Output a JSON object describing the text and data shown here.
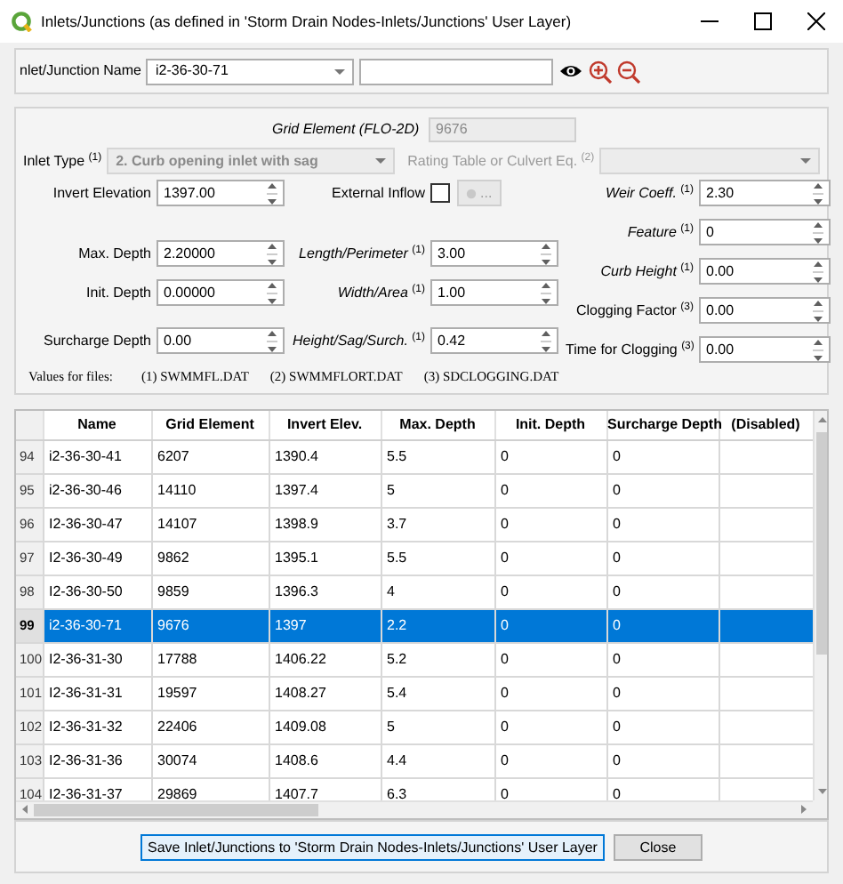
{
  "window": {
    "title": "Inlets/Junctions (as defined in 'Storm Drain Nodes-Inlets/Junctions' User Layer)"
  },
  "name_row": {
    "label": "nlet/Junction Name",
    "value": "i2-36-30-71"
  },
  "form": {
    "grid_element": {
      "label": "Grid Element (FLO-2D)",
      "italic": true,
      "value": "9676",
      "disabled": true
    },
    "inlet_type": {
      "label": "Inlet Type $^{(1)}$",
      "value": "2. Curb opening inlet with sag",
      "disabled": true
    },
    "rating_table": {
      "label": "Rating Table or Culvert Eq. $^{(2)}$",
      "disabled": true
    },
    "left": [
      {
        "label": "Invert Elevation",
        "value": "1397.00"
      },
      {
        "label": "Max. Depth",
        "value": "2.20000"
      },
      {
        "label": "Init. Depth",
        "value": "0.00000"
      },
      {
        "label": "Surcharge Depth",
        "value": "0.00"
      }
    ],
    "middle": [
      {
        "kind": "checkbox",
        "label": "External Inflow",
        "checked": false,
        "button_label": "...",
        "button_disabled": true
      },
      {
        "kind": "spin",
        "label": "*Length/Perimeter* $^{(1)}$",
        "value": "3.00"
      },
      {
        "kind": "spin",
        "label": "*Width/Area* $^{(1)}$",
        "value": "1.00"
      },
      {
        "kind": "spin",
        "label": "*Height/Sag/Surch.* $^{(1)}$",
        "value": "0.42"
      }
    ],
    "right": [
      {
        "label": "*Weir Coeff.* $^{(1)}$",
        "value": "2.30"
      },
      {
        "label": "*Feature* $^{(1)}$",
        "value": "0"
      },
      {
        "label": "*Curb Height* $^{(1)}$",
        "value": "0.00"
      },
      {
        "label": "Clogging Factor $^{(3)}$",
        "value": "0.00"
      },
      {
        "label": "Time for Clogging $^{(3)}$",
        "value": "0.00"
      }
    ],
    "notes": [
      "Values for files:",
      "(1) SWMMFL.DAT",
      "(2) SWMMFLORT.DAT",
      "(3) SDCLOGGING.DAT"
    ]
  },
  "table": {
    "columns": [
      "Name",
      "Grid Element",
      "Invert Elev.",
      "Max. Depth",
      "Init. Depth",
      "Surcharge Depth",
      "(Disabled)"
    ],
    "rows": [
      {
        "number": "94",
        "cells": [
          "i2-36-30-41",
          "6207",
          "1390.4",
          "5.5",
          "0",
          "0"
        ],
        "selected": false
      },
      {
        "number": "95",
        "cells": [
          "i2-36-30-46",
          "14110",
          "1397.4",
          "5",
          "0",
          "0"
        ],
        "selected": false
      },
      {
        "number": "96",
        "cells": [
          "I2-36-30-47",
          "14107",
          "1398.9",
          "3.7",
          "0",
          "0"
        ],
        "selected": false
      },
      {
        "number": "97",
        "cells": [
          "I2-36-30-49",
          "9862",
          "1395.1",
          "5.5",
          "0",
          "0"
        ],
        "selected": false
      },
      {
        "number": "98",
        "cells": [
          "I2-36-30-50",
          "9859",
          "1396.3",
          "4",
          "0",
          "0"
        ],
        "selected": false
      },
      {
        "number": "99",
        "cells": [
          "i2-36-30-71",
          "9676",
          "1397",
          "2.2",
          "0",
          "0"
        ],
        "selected": true
      },
      {
        "number": "100",
        "cells": [
          "I2-36-31-30",
          "17788",
          "1406.22",
          "5.2",
          "0",
          "0"
        ],
        "selected": false
      },
      {
        "number": "101",
        "cells": [
          "I2-36-31-31",
          "19597",
          "1408.27",
          "5.4",
          "0",
          "0"
        ],
        "selected": false
      },
      {
        "number": "102",
        "cells": [
          "I2-36-31-32",
          "22406",
          "1409.08",
          "5",
          "0",
          "0"
        ],
        "selected": false
      },
      {
        "number": "103",
        "cells": [
          "I2-36-31-36",
          "30074",
          "1408.6",
          "4.4",
          "0",
          "0"
        ],
        "selected": false
      },
      {
        "number": "104",
        "cells": [
          "I2-36-31-37",
          "29869",
          "1407.7",
          "6.3",
          "0",
          "0"
        ],
        "selected": false
      }
    ]
  },
  "buttons": [
    {
      "label": "Save Inlet/Junctions to 'Storm Drain Nodes-Inlets/Junctions' User Layer",
      "focused": true
    },
    {
      "label": "Close",
      "focused": false
    }
  ]
}
